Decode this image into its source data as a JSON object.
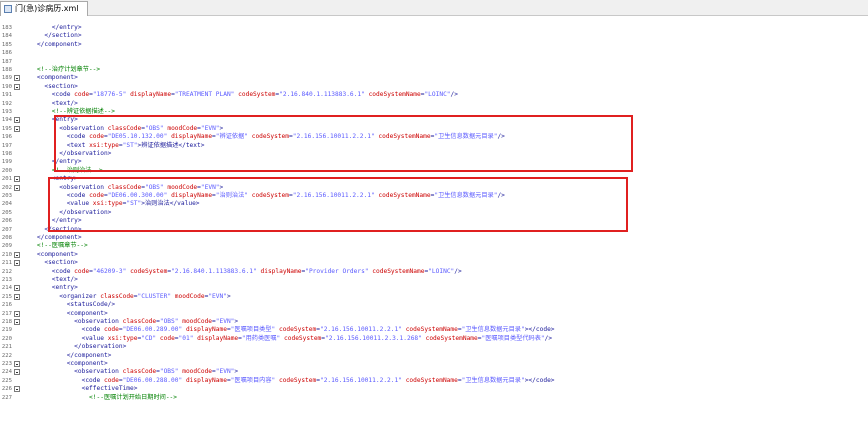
{
  "tab": {
    "title": "门(急)诊病历.xml"
  },
  "lines": [
    {
      "n": "183",
      "fold": false,
      "text": "        </entry>"
    },
    {
      "n": "184",
      "fold": false,
      "text": "      </section>"
    },
    {
      "n": "185",
      "fold": false,
      "text": "    </component>"
    },
    {
      "n": "186",
      "fold": false,
      "text": ""
    },
    {
      "n": "187",
      "fold": false,
      "text": ""
    },
    {
      "n": "188",
      "fold": false,
      "text": "    <!--治疗计划章节-->"
    },
    {
      "n": "189",
      "fold": true,
      "text": "    <component>"
    },
    {
      "n": "190",
      "fold": true,
      "text": "      <section>"
    },
    {
      "n": "191",
      "fold": false,
      "text": "        <code code=\"18776-5\" displayName=\"TREATMENT PLAN\" codeSystem=\"2.16.840.1.113883.6.1\" codeSystemName=\"LOINC\"/>"
    },
    {
      "n": "192",
      "fold": false,
      "text": "        <text/>"
    },
    {
      "n": "193",
      "fold": false,
      "text": "        <!--辨证依据描述-->"
    },
    {
      "n": "194",
      "fold": true,
      "text": "        <entry>"
    },
    {
      "n": "195",
      "fold": true,
      "text": "          <observation classCode=\"OBS\" moodCode=\"EVN\">"
    },
    {
      "n": "196",
      "fold": false,
      "text": "            <code code=\"DE05.10.132.00\" displayName=\"辨证依据\" codeSystem=\"2.16.156.10011.2.2.1\" codeSystemName=\"卫生信息数据元目录\"/>"
    },
    {
      "n": "197",
      "fold": false,
      "text": "            <text xsi:type=\"ST\">辨证依据描述</text>"
    },
    {
      "n": "198",
      "fold": false,
      "text": "          </observation>"
    },
    {
      "n": "199",
      "fold": false,
      "text": "        </entry>"
    },
    {
      "n": "200",
      "fold": false,
      "text": "        <!--治则治法-->"
    },
    {
      "n": "201",
      "fold": true,
      "text": "        <entry>"
    },
    {
      "n": "202",
      "fold": true,
      "text": "          <observation classCode=\"OBS\" moodCode=\"EVN\">"
    },
    {
      "n": "203",
      "fold": false,
      "text": "            <code code=\"DE06.00.300.00\" displayName=\"治则治法\" codeSystem=\"2.16.156.10011.2.2.1\" codeSystemName=\"卫生信息数据元目录\"/>"
    },
    {
      "n": "204",
      "fold": false,
      "text": "            <value xsi:type=\"ST\">治则治法</value>"
    },
    {
      "n": "205",
      "fold": false,
      "text": "          </observation>"
    },
    {
      "n": "206",
      "fold": false,
      "text": "        </entry>"
    },
    {
      "n": "207",
      "fold": false,
      "text": "      </section>"
    },
    {
      "n": "208",
      "fold": false,
      "text": "    </component>"
    },
    {
      "n": "209",
      "fold": false,
      "text": "    <!--医嘱章节-->"
    },
    {
      "n": "210",
      "fold": true,
      "text": "    <component>"
    },
    {
      "n": "211",
      "fold": true,
      "text": "      <section>"
    },
    {
      "n": "212",
      "fold": false,
      "text": "        <code code=\"46209-3\" codeSystem=\"2.16.840.1.113883.6.1\" displayName=\"Provider Orders\" codeSystemName=\"LOINC\"/>"
    },
    {
      "n": "213",
      "fold": false,
      "text": "        <text/>"
    },
    {
      "n": "214",
      "fold": true,
      "text": "        <entry>"
    },
    {
      "n": "215",
      "fold": true,
      "text": "          <organizer classCode=\"CLUSTER\" moodCode=\"EVN\">"
    },
    {
      "n": "216",
      "fold": false,
      "text": "            <statusCode/>"
    },
    {
      "n": "217",
      "fold": true,
      "text": "            <component>"
    },
    {
      "n": "218",
      "fold": true,
      "text": "              <observation classCode=\"OBS\" moodCode=\"EVN\">"
    },
    {
      "n": "219",
      "fold": false,
      "text": "                <code code=\"DE06.00.289.00\" displayName=\"医嘱项目类型\" codeSystem=\"2.16.156.10011.2.2.1\" codeSystemName=\"卫生信息数据元目录\"></code>"
    },
    {
      "n": "220",
      "fold": false,
      "text": "                <value xsi:type=\"CD\" code=\"01\" displayName=\"用药类医嘱\" codeSystem=\"2.16.156.10011.2.3.1.268\" codeSystemName=\"医嘱项目类型代码表\"/>"
    },
    {
      "n": "221",
      "fold": false,
      "text": "              </observation>"
    },
    {
      "n": "222",
      "fold": false,
      "text": "            </component>"
    },
    {
      "n": "223",
      "fold": true,
      "text": "            <component>"
    },
    {
      "n": "224",
      "fold": true,
      "text": "              <observation classCode=\"OBS\" moodCode=\"EVN\">"
    },
    {
      "n": "225",
      "fold": false,
      "text": "                <code code=\"DE06.00.288.00\" displayName=\"医嘱项目内容\" codeSystem=\"2.16.156.10011.2.2.1\" codeSystemName=\"卫生信息数据元目录\"></code>"
    },
    {
      "n": "226",
      "fold": true,
      "text": "                <effectiveTime>"
    },
    {
      "n": "227",
      "fold": false,
      "text": "                  <!--医嘱计划开始日期时间-->"
    }
  ],
  "highlight_colors": {
    "box": "#e02020"
  }
}
